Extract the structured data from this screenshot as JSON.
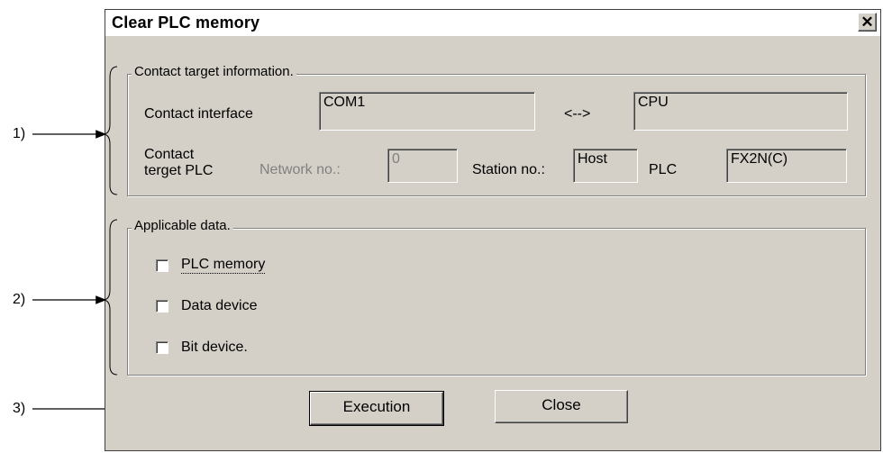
{
  "dialog": {
    "title": "Clear PLC memory",
    "close_glyph": "✕"
  },
  "contact": {
    "legend": "Contact target information.",
    "interface_label": "Contact interface",
    "interface_value": "COM1",
    "arrow": "<-->",
    "target_value": "CPU",
    "target_plc_label_line1": "Contact",
    "target_plc_label_line2": "terget PLC",
    "network_label": "Network no.:",
    "network_value": "0",
    "station_label": "Station no.:",
    "station_value": "Host",
    "plc_label": "PLC",
    "plc_value": "FX2N(C)"
  },
  "applicable": {
    "legend": "Applicable data.",
    "items": [
      {
        "label": "PLC memory",
        "checked": false
      },
      {
        "label": "Data device",
        "checked": false
      },
      {
        "label": "Bit device.",
        "checked": false
      }
    ]
  },
  "buttons": {
    "execution": "Execution",
    "close": "Close"
  },
  "callouts": [
    "1)",
    "2)",
    "3)"
  ]
}
